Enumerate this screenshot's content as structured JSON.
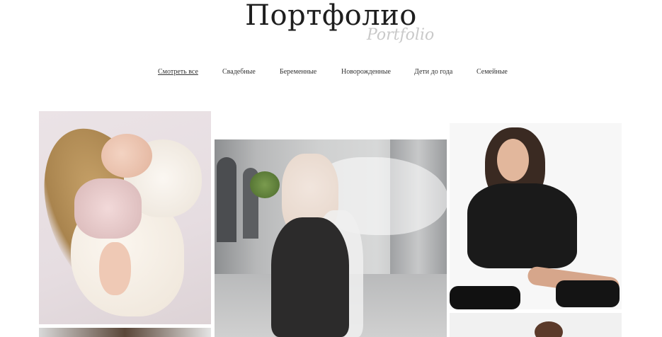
{
  "header": {
    "title": "Портфолио",
    "subtitle": "Portfolio"
  },
  "nav": {
    "items": [
      {
        "label": "Смотреть все",
        "active": true
      },
      {
        "label": "Свадебные",
        "active": false
      },
      {
        "label": "Беременные",
        "active": false
      },
      {
        "label": "Новорожденные",
        "active": false
      },
      {
        "label": "Дети до года",
        "active": false
      },
      {
        "label": "Семейные",
        "active": false
      }
    ]
  },
  "gallery": {
    "photos": [
      {
        "subject": "newborn-photo"
      },
      {
        "subject": "wedding-photo"
      },
      {
        "subject": "woman-portrait-photo"
      },
      {
        "subject": "portrait-photo-partial"
      },
      {
        "subject": "portrait-photo-partial"
      }
    ]
  },
  "colors": {
    "title": "#1e1e1e",
    "subtitle": "#c9c9c9",
    "nav_text": "#333333",
    "background": "#ffffff"
  }
}
